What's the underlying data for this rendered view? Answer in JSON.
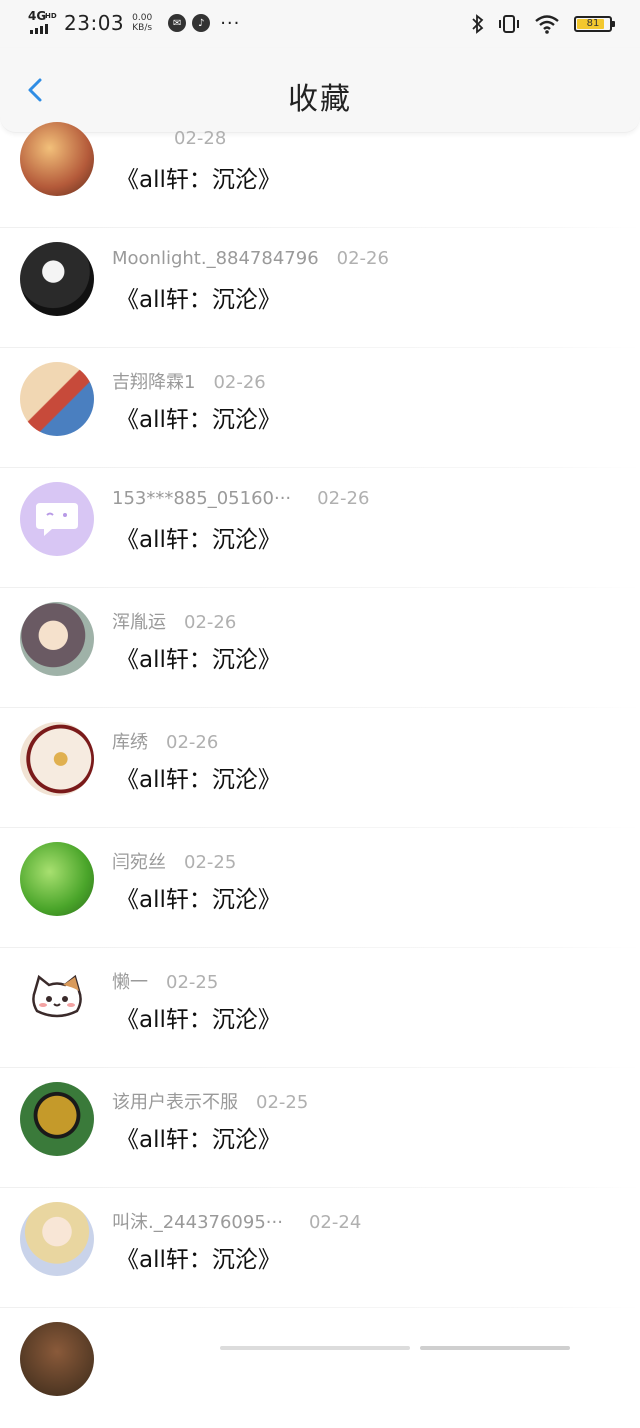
{
  "status": {
    "network": "4G",
    "network_sup": "HD",
    "time": "23:03",
    "speed_value": "0.00",
    "speed_unit": "KB/s",
    "more": "···",
    "battery": "81"
  },
  "nav": {
    "title": "收藏"
  },
  "items": [
    {
      "name": "",
      "date": "02-28",
      "book": "《all轩：沉沦》"
    },
    {
      "name": "Moonlight._884784796",
      "date": "02-26",
      "book": "《all轩：沉沦》"
    },
    {
      "name": "吉翔降霖1",
      "date": "02-26",
      "book": "《all轩：沉沦》"
    },
    {
      "name": "153***885_05160···",
      "date": "02-26",
      "book": "《all轩：沉沦》"
    },
    {
      "name": "浑胤运",
      "date": "02-26",
      "book": "《all轩：沉沦》"
    },
    {
      "name": "库绣",
      "date": "02-26",
      "book": "《all轩：沉沦》"
    },
    {
      "name": "闫宛丝",
      "date": "02-25",
      "book": "《all轩：沉沦》"
    },
    {
      "name": "懒一",
      "date": "02-25",
      "book": "《all轩：沉沦》"
    },
    {
      "name": "该用户表示不服",
      "date": "02-25",
      "book": "《all轩：沉沦》"
    },
    {
      "name": "叫沫._244376095···",
      "date": "02-24",
      "book": "《all轩：沉沦》"
    }
  ],
  "avatar_colors": [
    "#c98a5a",
    "#2a2a2a",
    "#e8c09a",
    "#d8c6f4",
    "#b9a79a",
    "#e8d3c0",
    "#5db53b",
    "#ffffff",
    "#2e6a3a",
    "#d9dbe8"
  ],
  "accent": "#2f8de4"
}
